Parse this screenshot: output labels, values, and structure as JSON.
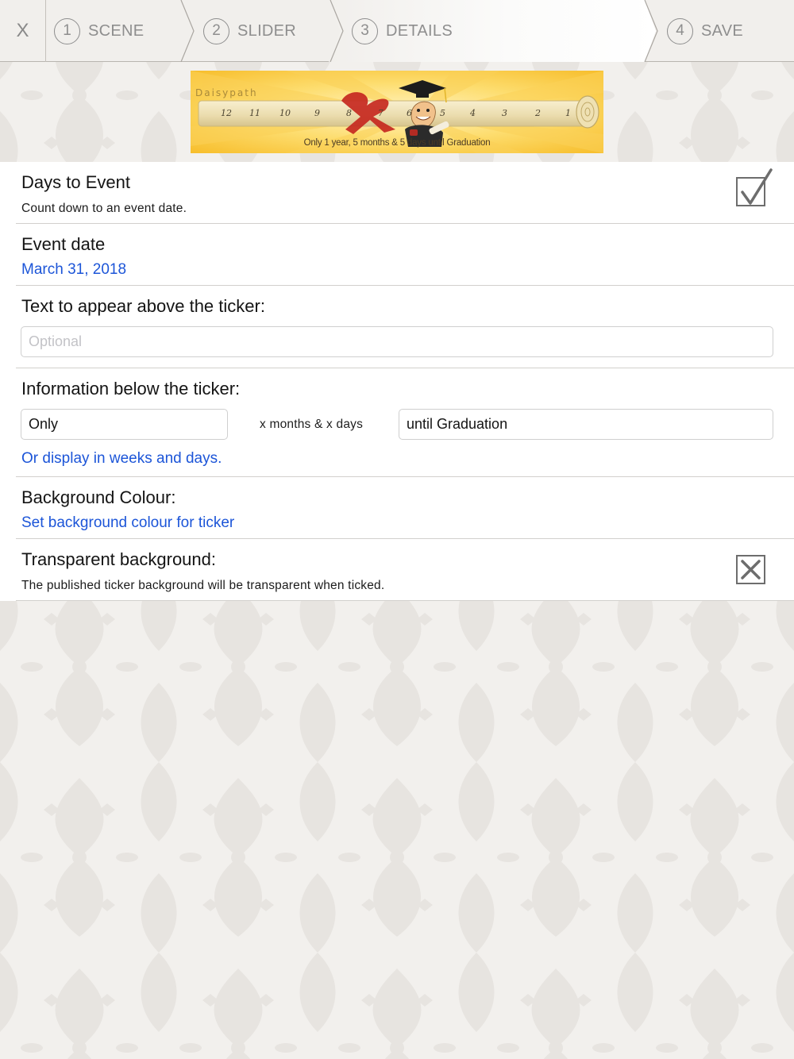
{
  "nav": {
    "close_label": "X",
    "steps": [
      {
        "number": "1",
        "label": "SCENE"
      },
      {
        "number": "2",
        "label": "SLIDER"
      },
      {
        "number": "3",
        "label": "DETAILS"
      },
      {
        "number": "4",
        "label": "SAVE"
      }
    ],
    "active_step": 3
  },
  "banner": {
    "brand": "Daisypath",
    "ruler_numbers": [
      "12",
      "11",
      "10",
      "9",
      "8",
      "7",
      "6",
      "5",
      "4",
      "3",
      "2",
      "1"
    ],
    "caption": "Only 1 year, 5 months & 5 days until Graduation",
    "colors": {
      "sun": "#f9c93a",
      "ray": "#fde07b",
      "scroll": "#f1e3b8",
      "ribbon": "#c6281f"
    }
  },
  "form": {
    "days_to_event": {
      "title": "Days to Event",
      "subtitle": "Count down to an event date.",
      "checked": true
    },
    "event_date": {
      "title": "Event date",
      "value": "March 31, 2018"
    },
    "text_above": {
      "title": "Text to appear above the ticker:",
      "placeholder": "Optional",
      "value": ""
    },
    "info_below": {
      "title": "Information below the ticker:",
      "prefix_value": "Only",
      "middle_label": "x months & x days",
      "suffix_value": "until Graduation",
      "weeks_link": "Or display in weeks and days."
    },
    "background_colour": {
      "title": "Background Colour:",
      "link": "Set background colour for ticker"
    },
    "transparent_background": {
      "title": "Transparent background:",
      "subtitle": "The published ticker background will be transparent when ticked.",
      "checked": false
    }
  },
  "colors": {
    "link": "#1c55d8",
    "page_background": "#f2f0ed",
    "step_text": "#8e8e8e"
  }
}
